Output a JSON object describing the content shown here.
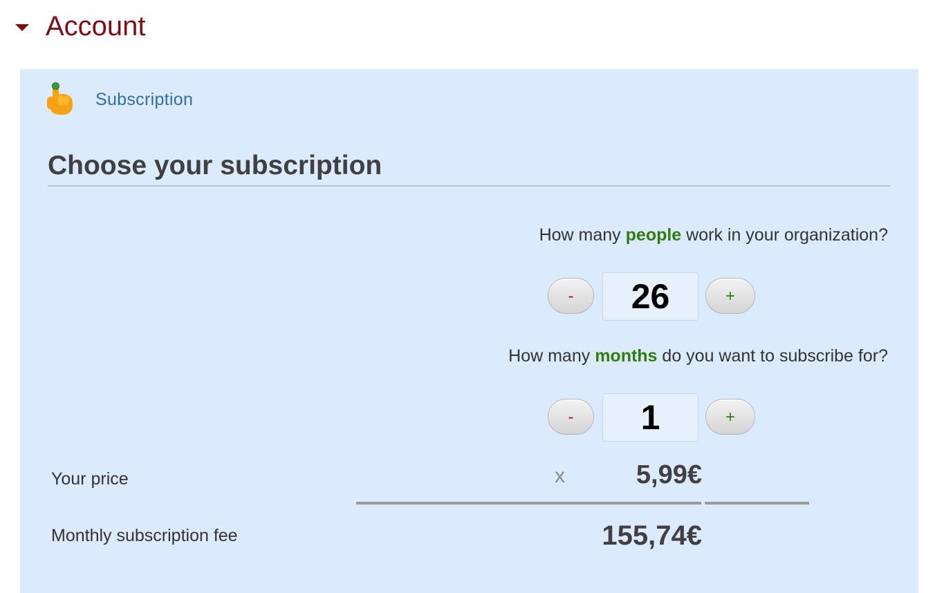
{
  "section": {
    "title": "Account",
    "expanded": true
  },
  "subscription_link": {
    "label": "Subscription",
    "icon": "pointing-hand-icon"
  },
  "heading": "Choose your subscription",
  "people_question": {
    "prefix": "How many ",
    "highlight": "people",
    "suffix": " work in your organization?"
  },
  "people_stepper": {
    "minus": "-",
    "value": "26",
    "plus": "+"
  },
  "months_question": {
    "prefix": "How many ",
    "highlight": "months",
    "suffix": " do you want to subscribe for?"
  },
  "months_stepper": {
    "minus": "-",
    "value": "1",
    "plus": "+"
  },
  "price": {
    "label": "Your price",
    "operator": "x",
    "value": "5,99€"
  },
  "fee": {
    "label": "Monthly subscription fee",
    "value": "155,74€"
  },
  "colors": {
    "section_title": "#7d0d16",
    "panel_bg": "#dceafd",
    "link": "#2e6ea8",
    "highlight": "#2e7d0e",
    "minus": "#a31515",
    "plus": "#2e7d0e"
  }
}
